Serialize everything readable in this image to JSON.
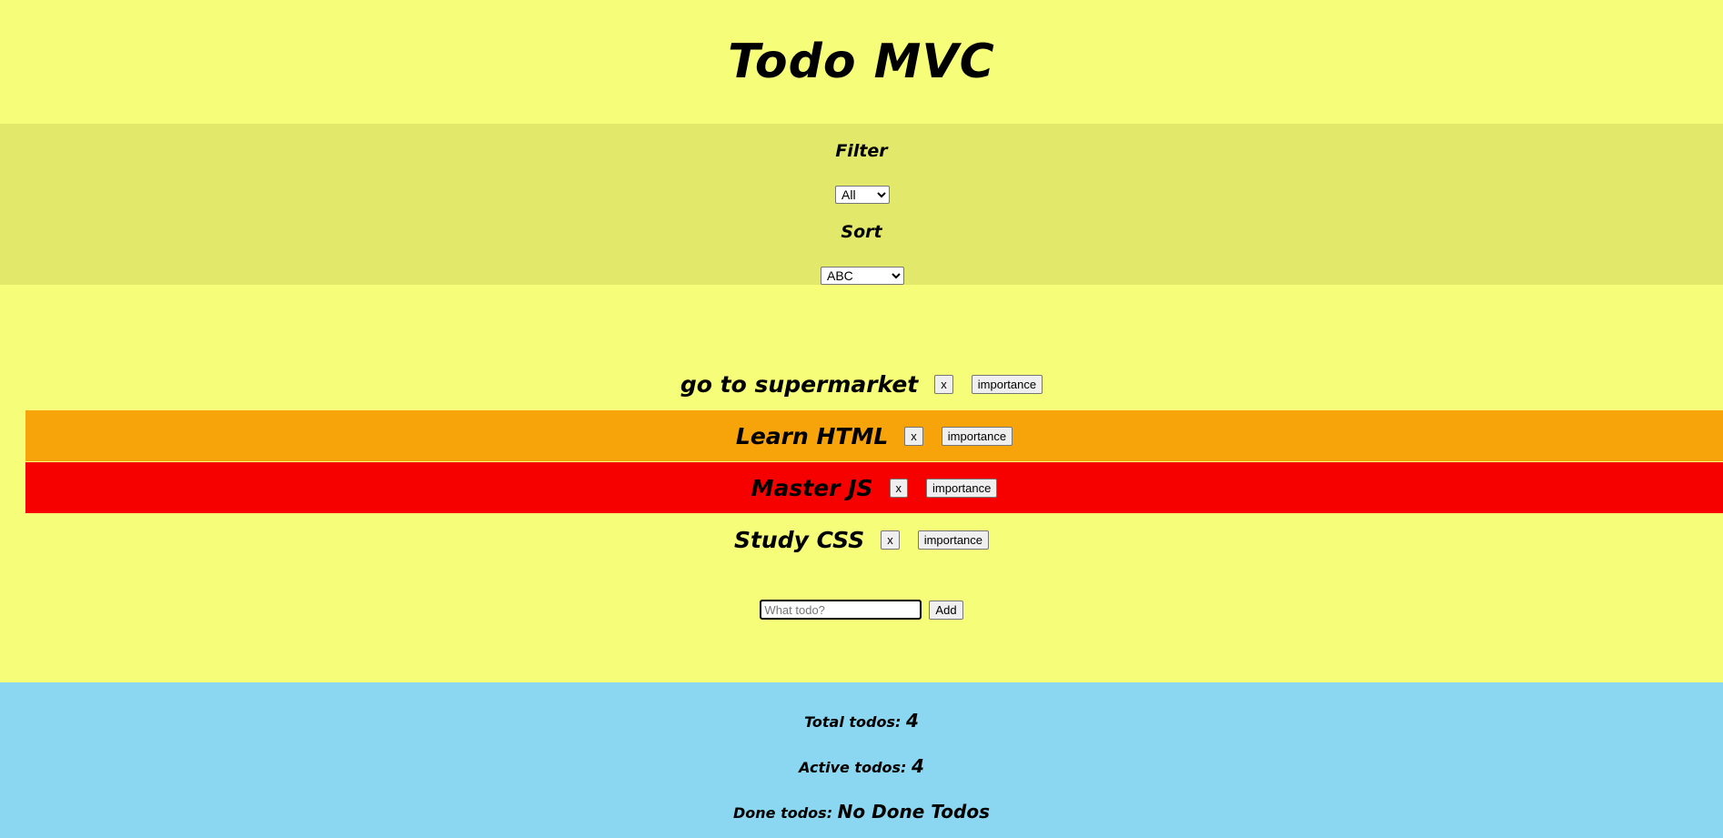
{
  "app": {
    "title": "Todo MVC"
  },
  "filter": {
    "label": "Filter",
    "selected": "All"
  },
  "sort": {
    "label": "Sort",
    "selected": "ABC"
  },
  "todos": [
    {
      "text": "go to supermarket",
      "importance": "normal",
      "remove_label": "x",
      "importance_label": "importance"
    },
    {
      "text": "Learn HTML",
      "importance": "medium",
      "remove_label": "x",
      "importance_label": "importance"
    },
    {
      "text": "Master JS",
      "importance": "high",
      "remove_label": "x",
      "importance_label": "importance"
    },
    {
      "text": "Study CSS",
      "importance": "normal",
      "remove_label": "x",
      "importance_label": "importance"
    }
  ],
  "add": {
    "placeholder": "What todo?",
    "value": "",
    "button_label": "Add"
  },
  "stats": {
    "total_label": "Total todos:",
    "total_value": "4",
    "active_label": "Active todos:",
    "active_value": "4",
    "done_label": "Done todos:",
    "done_value": "No Done Todos"
  },
  "colors": {
    "background": "#f6fd78",
    "controls_background": "#e1e86a",
    "importance_medium": "#f7a30a",
    "importance_high": "#f70000",
    "stats_background": "#8bd6f1"
  }
}
